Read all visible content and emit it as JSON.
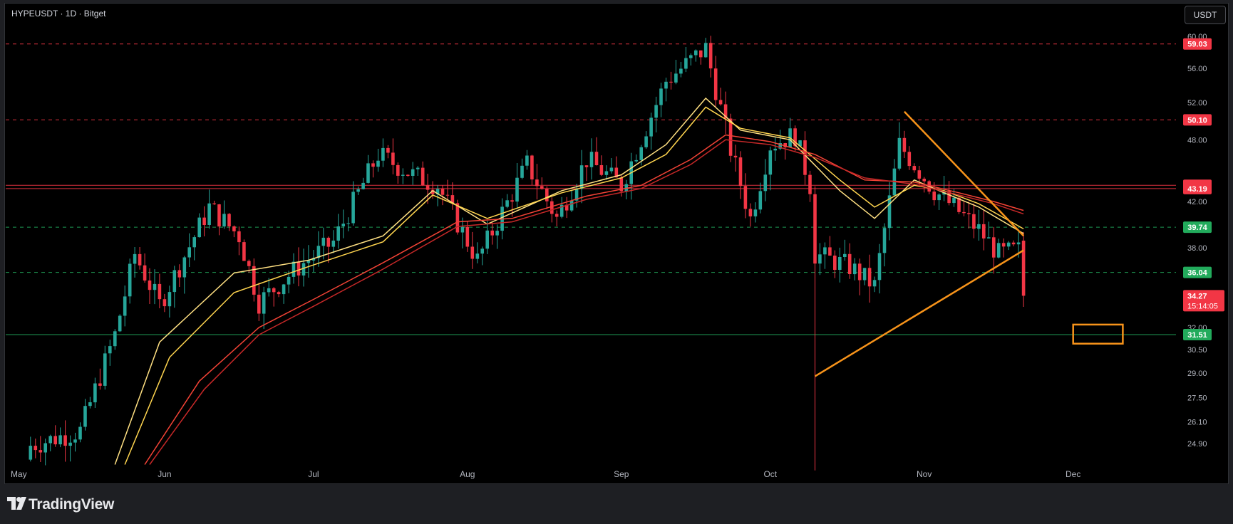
{
  "header": {
    "symbol_title": "HYPEUSDT · 1D · Bitget",
    "currency_label": "USDT"
  },
  "footer": {
    "brand": "TradingView"
  },
  "colors": {
    "up": "#26a69a",
    "down": "#f23645",
    "ema_fast": "#ffe082",
    "ema_mid": "#ffd54f",
    "ema_slow": "#f44336",
    "ema_slow2": "#c62828",
    "trendline": "#f7931a",
    "label_red": "#f23645",
    "label_green": "#22ab5c",
    "support_line": "#22ab5c",
    "resistance_line": "#f23645",
    "axis_text": "#b2b5be"
  },
  "chart_data": {
    "type": "candlestick",
    "symbol": "HYPEUSDT",
    "interval": "1D",
    "exchange": "Bitget",
    "y_scale": "log",
    "ylim": [
      23.5,
      61.5
    ],
    "x_months": [
      "May",
      "Jun",
      "Jul",
      "Aug",
      "Sep",
      "Oct",
      "Nov",
      "Dec"
    ],
    "y_ticks": [
      "60.00",
      "56.00",
      "52.00",
      "48.00",
      "42.00",
      "38.00",
      "32.00",
      "30.50",
      "29.00",
      "27.50",
      "26.10",
      "24.90"
    ],
    "price_levels": [
      {
        "value": 59.03,
        "label": "59.03",
        "style": "dashed",
        "color": "red"
      },
      {
        "value": 50.1,
        "label": "50.10",
        "style": "dashed",
        "color": "red"
      },
      {
        "value": 43.5,
        "label": "43.50",
        "style": "solid",
        "color": "red"
      },
      {
        "value": 43.19,
        "label": "43.19",
        "style": "solid",
        "color": "red"
      },
      {
        "value": 39.74,
        "label": "39.74",
        "style": "dashed",
        "color": "green"
      },
      {
        "value": 36.04,
        "label": "36.04",
        "style": "dashed",
        "color": "green"
      },
      {
        "value": 31.51,
        "label": "31.51",
        "style": "solid",
        "color": "green"
      }
    ],
    "last_price": {
      "value": 34.27,
      "label": "34.27",
      "countdown": "15:14:05"
    },
    "ohlc_daily_close_keypoints": [
      {
        "date": "2025-05-05",
        "close": 24.8
      },
      {
        "date": "2025-05-15",
        "close": 25.6
      },
      {
        "date": "2025-05-22",
        "close": 31.5
      },
      {
        "date": "2025-05-26",
        "close": 37.5
      },
      {
        "date": "2025-05-31",
        "close": 33.6
      },
      {
        "date": "2025-06-10",
        "close": 41.5
      },
      {
        "date": "2025-06-16",
        "close": 39.0
      },
      {
        "date": "2025-06-20",
        "close": 33.8
      },
      {
        "date": "2025-06-28",
        "close": 36.5
      },
      {
        "date": "2025-07-05",
        "close": 38.5
      },
      {
        "date": "2025-07-14",
        "close": 46.5
      },
      {
        "date": "2025-07-21",
        "close": 44.5
      },
      {
        "date": "2025-07-26",
        "close": 43.5
      },
      {
        "date": "2025-08-03",
        "close": 37.0
      },
      {
        "date": "2025-08-13",
        "close": 45.5
      },
      {
        "date": "2025-08-19",
        "close": 40.5
      },
      {
        "date": "2025-08-25",
        "close": 46.0
      },
      {
        "date": "2025-09-01",
        "close": 43.5
      },
      {
        "date": "2025-09-10",
        "close": 54.5
      },
      {
        "date": "2025-09-18",
        "close": 58.5
      },
      {
        "date": "2025-09-23",
        "close": 47.0
      },
      {
        "date": "2025-09-27",
        "close": 40.5
      },
      {
        "date": "2025-10-01",
        "close": 47.5
      },
      {
        "date": "2025-10-06",
        "close": 48.5
      },
      {
        "date": "2025-10-09",
        "close": 43.5
      },
      {
        "date": "2025-10-10",
        "close": 37.5
      },
      {
        "date": "2025-10-17",
        "close": 36.5
      },
      {
        "date": "2025-10-22",
        "close": 35.0
      },
      {
        "date": "2025-10-27",
        "close": 47.5
      },
      {
        "date": "2025-11-03",
        "close": 43.0
      },
      {
        "date": "2025-11-07",
        "close": 41.5
      },
      {
        "date": "2025-11-12",
        "close": 39.5
      },
      {
        "date": "2025-11-16",
        "close": 37.5
      },
      {
        "date": "2025-11-20",
        "close": 37.8
      },
      {
        "date": "2025-11-21",
        "close": 34.27
      }
    ],
    "flash_crash": {
      "date": "2025-10-10",
      "low": 23.5
    },
    "ema_lines": [
      {
        "name_hidden": true,
        "color": "ema_fast",
        "points": [
          [
            "2025-05-22",
            23.8
          ],
          [
            "2025-05-31",
            31
          ],
          [
            "2025-06-15",
            36
          ],
          [
            "2025-06-30",
            37
          ],
          [
            "2025-07-15",
            39
          ],
          [
            "2025-07-25",
            43
          ],
          [
            "2025-08-05",
            40
          ],
          [
            "2025-08-20",
            43
          ],
          [
            "2025-09-01",
            44.5
          ],
          [
            "2025-09-10",
            47.5
          ],
          [
            "2025-09-18",
            52.5
          ],
          [
            "2025-09-25",
            49
          ],
          [
            "2025-10-05",
            48
          ],
          [
            "2025-10-15",
            43
          ],
          [
            "2025-10-22",
            40.5
          ],
          [
            "2025-10-30",
            44
          ],
          [
            "2025-11-05",
            42.8
          ],
          [
            "2025-11-12",
            41.5
          ],
          [
            "2025-11-21",
            39.2
          ]
        ]
      },
      {
        "name_hidden": true,
        "color": "ema_mid",
        "points": [
          [
            "2025-05-24",
            23.8
          ],
          [
            "2025-06-02",
            30
          ],
          [
            "2025-06-15",
            34.5
          ],
          [
            "2025-06-30",
            36.5
          ],
          [
            "2025-07-15",
            38.5
          ],
          [
            "2025-07-25",
            42.6
          ],
          [
            "2025-08-05",
            40.5
          ],
          [
            "2025-08-20",
            42.8
          ],
          [
            "2025-09-01",
            44.2
          ],
          [
            "2025-09-10",
            46.5
          ],
          [
            "2025-09-18",
            51.5
          ],
          [
            "2025-09-25",
            49.2
          ],
          [
            "2025-10-05",
            48.2
          ],
          [
            "2025-10-15",
            44
          ],
          [
            "2025-10-22",
            41.5
          ],
          [
            "2025-10-30",
            43.5
          ],
          [
            "2025-11-05",
            43
          ],
          [
            "2025-11-12",
            41.8
          ],
          [
            "2025-11-21",
            39.6
          ]
        ]
      },
      {
        "name_hidden": true,
        "color": "ema_slow",
        "points": [
          [
            "2025-05-28",
            23.8
          ],
          [
            "2025-06-08",
            28.5
          ],
          [
            "2025-06-20",
            32
          ],
          [
            "2025-07-01",
            34
          ],
          [
            "2025-07-15",
            36.8
          ],
          [
            "2025-07-30",
            40.2
          ],
          [
            "2025-08-10",
            40.5
          ],
          [
            "2025-08-25",
            42.5
          ],
          [
            "2025-09-05",
            43.5
          ],
          [
            "2025-09-15",
            46
          ],
          [
            "2025-09-22",
            48.5
          ],
          [
            "2025-10-01",
            47.8
          ],
          [
            "2025-10-10",
            46.5
          ],
          [
            "2025-10-20",
            44
          ],
          [
            "2025-10-30",
            43.8
          ],
          [
            "2025-11-08",
            42.8
          ],
          [
            "2025-11-15",
            42
          ],
          [
            "2025-11-21",
            41.2
          ]
        ]
      },
      {
        "name_hidden": true,
        "color": "ema_slow2",
        "points": [
          [
            "2025-05-29",
            23.8
          ],
          [
            "2025-06-09",
            28
          ],
          [
            "2025-06-20",
            31.5
          ],
          [
            "2025-07-01",
            33.5
          ],
          [
            "2025-07-15",
            36.3
          ],
          [
            "2025-07-30",
            39.8
          ],
          [
            "2025-08-10",
            40.2
          ],
          [
            "2025-08-25",
            42.2
          ],
          [
            "2025-09-05",
            43.2
          ],
          [
            "2025-09-15",
            45.5
          ],
          [
            "2025-09-22",
            48
          ],
          [
            "2025-10-01",
            47.5
          ],
          [
            "2025-10-10",
            46.2
          ],
          [
            "2025-10-20",
            44.2
          ],
          [
            "2025-10-30",
            43.6
          ],
          [
            "2025-11-08",
            42.6
          ],
          [
            "2025-11-15",
            41.8
          ],
          [
            "2025-11-21",
            40.9
          ]
        ]
      }
    ],
    "drawings": {
      "descending_trendline": [
        [
          "2025-10-28",
          51.0
        ],
        [
          "2025-11-21",
          39.0
        ]
      ],
      "ascending_trendline": [
        [
          "2025-10-10",
          28.8
        ],
        [
          "2025-11-21",
          37.8
        ]
      ],
      "target_box": {
        "x0": "2025-12-01",
        "x1": "2025-12-11",
        "y0": 32.2,
        "y1": 30.9
      }
    }
  }
}
